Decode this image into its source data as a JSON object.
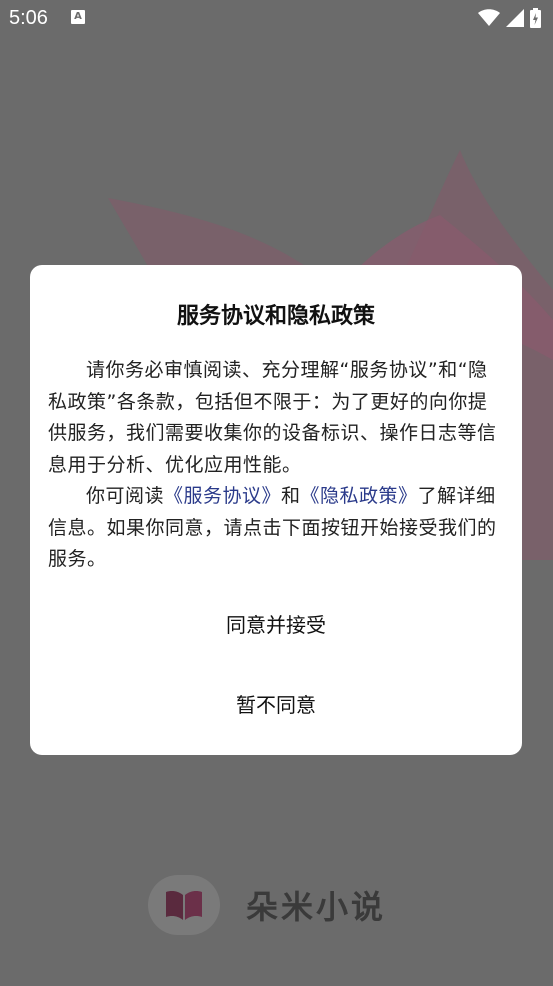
{
  "status_bar": {
    "time": "5:06",
    "notification_icon": "a-letter-icon",
    "icons": [
      "wifi-icon",
      "signal-icon",
      "battery-charging-icon"
    ]
  },
  "dialog": {
    "title": "服务协议和隐私政策",
    "paragraph1": "请你务必审慎阅读、充分理解“服务协议”和“隐私政策”各条款，包括但不限于：为了更好的向你提供服务，我们需要收集你的设备标识、操作日志等信息用于分析、优化应用性能。",
    "paragraph2_prefix": "你可阅读",
    "service_link": "《服务协议》",
    "paragraph2_and": "和",
    "privacy_link": "《隐私政策》",
    "paragraph2_suffix": "了解详细信息。如果你同意，请点击下面按钮开始接受我们的服务。",
    "agree_button": "同意并接受",
    "decline_button": "暂不同意"
  },
  "brand": {
    "app_name": "朵米小说",
    "logo_icon": "open-book-icon"
  },
  "colors": {
    "scrim": "#6b6b6b",
    "link": "#2a3a8a",
    "brand_accent": "#a0355f"
  }
}
